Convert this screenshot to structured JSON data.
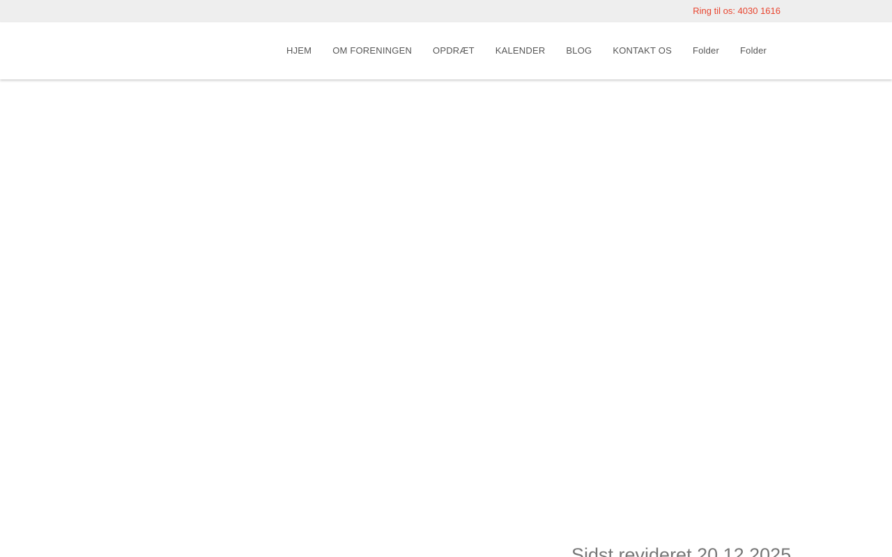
{
  "topbar": {
    "phone_text": "Ring til os: 4030 1616",
    "phone_color": "#e8442e",
    "background": "#eeeeee"
  },
  "nav": {
    "items": [
      {
        "label": "HJEM"
      },
      {
        "label": "OM FORENINGEN"
      },
      {
        "label": "OPDRÆT"
      },
      {
        "label": "KALENDER"
      },
      {
        "label": "BLOG"
      },
      {
        "label": "KONTAKT OS"
      },
      {
        "label": "Folder"
      },
      {
        "label": "Folder"
      }
    ]
  },
  "main": {
    "revised_text": "Sidst revideret 20.12.2025"
  }
}
